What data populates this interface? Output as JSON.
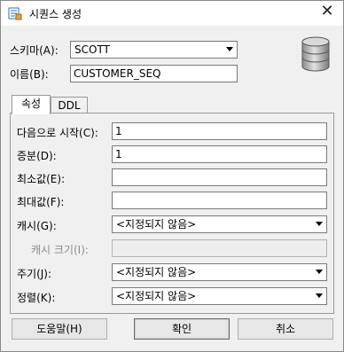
{
  "window": {
    "title": "시퀀스 생성",
    "close_glyph": "✕"
  },
  "schema": {
    "label": "스키마(A):",
    "value": "SCOTT"
  },
  "name": {
    "label": "이름(B):",
    "value": "CUSTOMER_SEQ"
  },
  "tabs": [
    {
      "label": "속성",
      "active": true
    },
    {
      "label": "DDL",
      "active": false
    }
  ],
  "properties": {
    "start_with": {
      "label": "다음으로 시작(C):",
      "value": "1"
    },
    "increment": {
      "label": "증분(D):",
      "value": "1"
    },
    "min_value": {
      "label": "최소값(E):",
      "value": ""
    },
    "max_value": {
      "label": "최대값(F):",
      "value": ""
    },
    "cache": {
      "label": "캐시(G):",
      "value": "<지정되지 않음>"
    },
    "cache_size": {
      "label": "캐시 크기(I):",
      "value": ""
    },
    "cycle": {
      "label": "주기(J):",
      "value": "<지정되지 않음>"
    },
    "order": {
      "label": "정렬(K):",
      "value": "<지정되지 않음>"
    }
  },
  "buttons": {
    "help": "도움말(H)",
    "ok": "확인",
    "cancel": "취소"
  },
  "icons": {
    "title": "sequence-icon",
    "database": "database-icon"
  }
}
